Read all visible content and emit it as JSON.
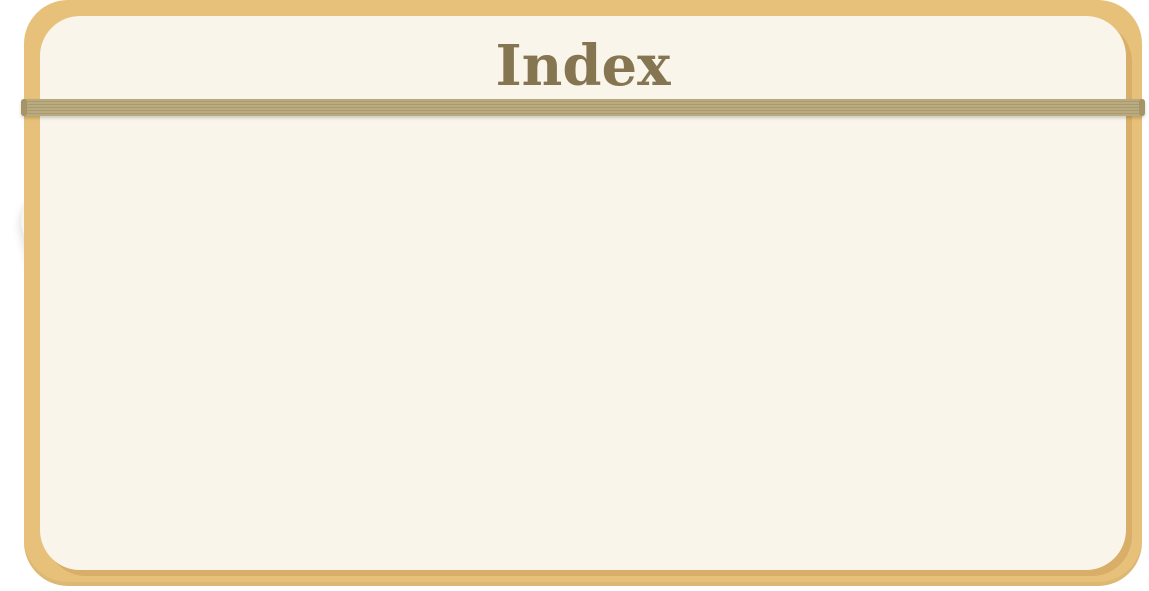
{
  "index_panel": {
    "title": "Index",
    "entries": []
  },
  "colors": {
    "frame": "#e7c07a",
    "panel": "#f9f5eb",
    "title": "#857651",
    "divider": "#b9aa80"
  }
}
